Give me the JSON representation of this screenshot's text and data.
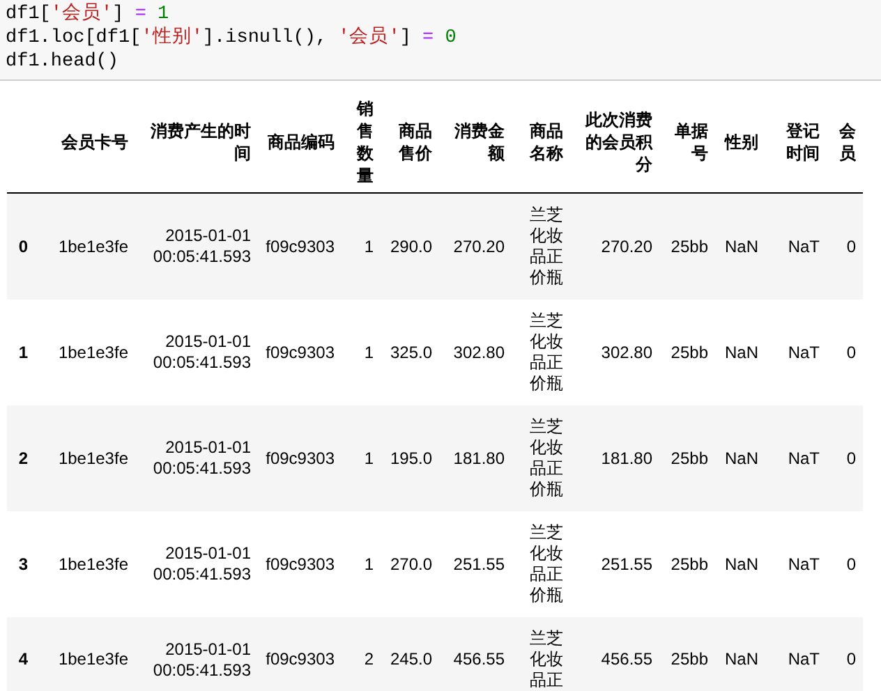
{
  "code_cell": {
    "lines": [
      [
        {
          "text": "df1[",
          "kind": "plain"
        },
        {
          "text": "'会员'",
          "kind": "string"
        },
        {
          "text": "] ",
          "kind": "plain"
        },
        {
          "text": "= ",
          "kind": "operator"
        },
        {
          "text": "1",
          "kind": "number"
        }
      ],
      [
        {
          "text": "df1.loc[df1[",
          "kind": "plain"
        },
        {
          "text": "'性别'",
          "kind": "string"
        },
        {
          "text": "].isnull(), ",
          "kind": "plain"
        },
        {
          "text": "'会员'",
          "kind": "string"
        },
        {
          "text": "] ",
          "kind": "plain"
        },
        {
          "text": "= ",
          "kind": "operator"
        },
        {
          "text": "0",
          "kind": "number"
        }
      ],
      [
        {
          "text": "df1.head()",
          "kind": "plain"
        }
      ]
    ]
  },
  "table": {
    "columns": [
      "会员卡号",
      "消费产生的时间",
      "商品编码",
      "销售数量",
      "商品售价",
      "消费金额",
      "商品名称",
      "此次消费的会员积分",
      "单据号",
      "性别",
      "登记时间",
      "会员"
    ],
    "rows": [
      {
        "index": "0",
        "cells": [
          "1be1e3fe",
          "2015-01-01 00:05:41.593",
          "f09c9303",
          "1",
          "290.0",
          "270.20",
          "兰芝化妆品正价瓶",
          "270.20",
          "25bb",
          "NaN",
          "NaT",
          "0"
        ]
      },
      {
        "index": "1",
        "cells": [
          "1be1e3fe",
          "2015-01-01 00:05:41.593",
          "f09c9303",
          "1",
          "325.0",
          "302.80",
          "兰芝化妆品正价瓶",
          "302.80",
          "25bb",
          "NaN",
          "NaT",
          "0"
        ]
      },
      {
        "index": "2",
        "cells": [
          "1be1e3fe",
          "2015-01-01 00:05:41.593",
          "f09c9303",
          "1",
          "195.0",
          "181.80",
          "兰芝化妆品正价瓶",
          "181.80",
          "25bb",
          "NaN",
          "NaT",
          "0"
        ]
      },
      {
        "index": "3",
        "cells": [
          "1be1e3fe",
          "2015-01-01 00:05:41.593",
          "f09c9303",
          "1",
          "270.0",
          "251.55",
          "兰芝化妆品正价瓶",
          "251.55",
          "25bb",
          "NaN",
          "NaT",
          "0"
        ]
      },
      {
        "index": "4",
        "cells": [
          "1be1e3fe",
          "2015-01-01 00:05:41.593",
          "f09c9303",
          "2",
          "245.0",
          "456.55",
          "兰芝化妆品正",
          "456.55",
          "25bb",
          "NaN",
          "NaT",
          "0"
        ]
      }
    ]
  }
}
